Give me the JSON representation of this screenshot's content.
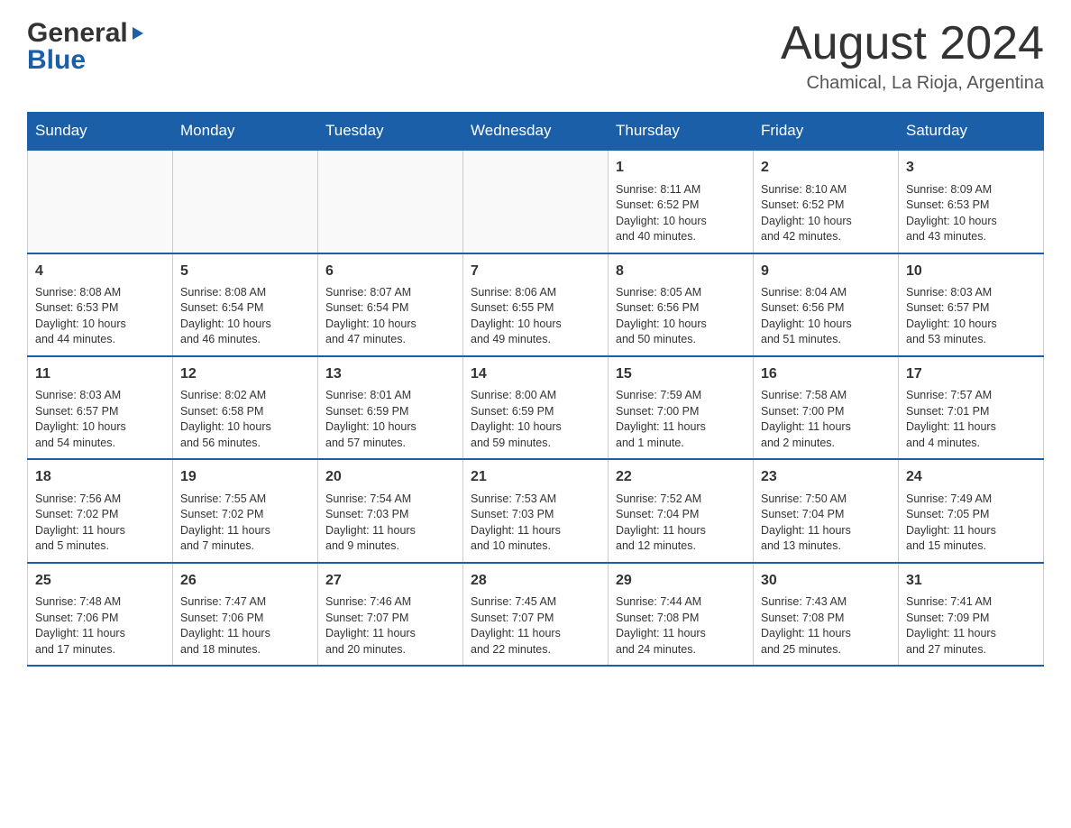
{
  "header": {
    "logo_general": "General",
    "logo_blue": "Blue",
    "month_title": "August 2024",
    "location": "Chamical, La Rioja, Argentina"
  },
  "calendar": {
    "days_of_week": [
      "Sunday",
      "Monday",
      "Tuesday",
      "Wednesday",
      "Thursday",
      "Friday",
      "Saturday"
    ],
    "weeks": [
      [
        {
          "day": "",
          "info": ""
        },
        {
          "day": "",
          "info": ""
        },
        {
          "day": "",
          "info": ""
        },
        {
          "day": "",
          "info": ""
        },
        {
          "day": "1",
          "info": "Sunrise: 8:11 AM\nSunset: 6:52 PM\nDaylight: 10 hours\nand 40 minutes."
        },
        {
          "day": "2",
          "info": "Sunrise: 8:10 AM\nSunset: 6:52 PM\nDaylight: 10 hours\nand 42 minutes."
        },
        {
          "day": "3",
          "info": "Sunrise: 8:09 AM\nSunset: 6:53 PM\nDaylight: 10 hours\nand 43 minutes."
        }
      ],
      [
        {
          "day": "4",
          "info": "Sunrise: 8:08 AM\nSunset: 6:53 PM\nDaylight: 10 hours\nand 44 minutes."
        },
        {
          "day": "5",
          "info": "Sunrise: 8:08 AM\nSunset: 6:54 PM\nDaylight: 10 hours\nand 46 minutes."
        },
        {
          "day": "6",
          "info": "Sunrise: 8:07 AM\nSunset: 6:54 PM\nDaylight: 10 hours\nand 47 minutes."
        },
        {
          "day": "7",
          "info": "Sunrise: 8:06 AM\nSunset: 6:55 PM\nDaylight: 10 hours\nand 49 minutes."
        },
        {
          "day": "8",
          "info": "Sunrise: 8:05 AM\nSunset: 6:56 PM\nDaylight: 10 hours\nand 50 minutes."
        },
        {
          "day": "9",
          "info": "Sunrise: 8:04 AM\nSunset: 6:56 PM\nDaylight: 10 hours\nand 51 minutes."
        },
        {
          "day": "10",
          "info": "Sunrise: 8:03 AM\nSunset: 6:57 PM\nDaylight: 10 hours\nand 53 minutes."
        }
      ],
      [
        {
          "day": "11",
          "info": "Sunrise: 8:03 AM\nSunset: 6:57 PM\nDaylight: 10 hours\nand 54 minutes."
        },
        {
          "day": "12",
          "info": "Sunrise: 8:02 AM\nSunset: 6:58 PM\nDaylight: 10 hours\nand 56 minutes."
        },
        {
          "day": "13",
          "info": "Sunrise: 8:01 AM\nSunset: 6:59 PM\nDaylight: 10 hours\nand 57 minutes."
        },
        {
          "day": "14",
          "info": "Sunrise: 8:00 AM\nSunset: 6:59 PM\nDaylight: 10 hours\nand 59 minutes."
        },
        {
          "day": "15",
          "info": "Sunrise: 7:59 AM\nSunset: 7:00 PM\nDaylight: 11 hours\nand 1 minute."
        },
        {
          "day": "16",
          "info": "Sunrise: 7:58 AM\nSunset: 7:00 PM\nDaylight: 11 hours\nand 2 minutes."
        },
        {
          "day": "17",
          "info": "Sunrise: 7:57 AM\nSunset: 7:01 PM\nDaylight: 11 hours\nand 4 minutes."
        }
      ],
      [
        {
          "day": "18",
          "info": "Sunrise: 7:56 AM\nSunset: 7:02 PM\nDaylight: 11 hours\nand 5 minutes."
        },
        {
          "day": "19",
          "info": "Sunrise: 7:55 AM\nSunset: 7:02 PM\nDaylight: 11 hours\nand 7 minutes."
        },
        {
          "day": "20",
          "info": "Sunrise: 7:54 AM\nSunset: 7:03 PM\nDaylight: 11 hours\nand 9 minutes."
        },
        {
          "day": "21",
          "info": "Sunrise: 7:53 AM\nSunset: 7:03 PM\nDaylight: 11 hours\nand 10 minutes."
        },
        {
          "day": "22",
          "info": "Sunrise: 7:52 AM\nSunset: 7:04 PM\nDaylight: 11 hours\nand 12 minutes."
        },
        {
          "day": "23",
          "info": "Sunrise: 7:50 AM\nSunset: 7:04 PM\nDaylight: 11 hours\nand 13 minutes."
        },
        {
          "day": "24",
          "info": "Sunrise: 7:49 AM\nSunset: 7:05 PM\nDaylight: 11 hours\nand 15 minutes."
        }
      ],
      [
        {
          "day": "25",
          "info": "Sunrise: 7:48 AM\nSunset: 7:06 PM\nDaylight: 11 hours\nand 17 minutes."
        },
        {
          "day": "26",
          "info": "Sunrise: 7:47 AM\nSunset: 7:06 PM\nDaylight: 11 hours\nand 18 minutes."
        },
        {
          "day": "27",
          "info": "Sunrise: 7:46 AM\nSunset: 7:07 PM\nDaylight: 11 hours\nand 20 minutes."
        },
        {
          "day": "28",
          "info": "Sunrise: 7:45 AM\nSunset: 7:07 PM\nDaylight: 11 hours\nand 22 minutes."
        },
        {
          "day": "29",
          "info": "Sunrise: 7:44 AM\nSunset: 7:08 PM\nDaylight: 11 hours\nand 24 minutes."
        },
        {
          "day": "30",
          "info": "Sunrise: 7:43 AM\nSunset: 7:08 PM\nDaylight: 11 hours\nand 25 minutes."
        },
        {
          "day": "31",
          "info": "Sunrise: 7:41 AM\nSunset: 7:09 PM\nDaylight: 11 hours\nand 27 minutes."
        }
      ]
    ]
  }
}
